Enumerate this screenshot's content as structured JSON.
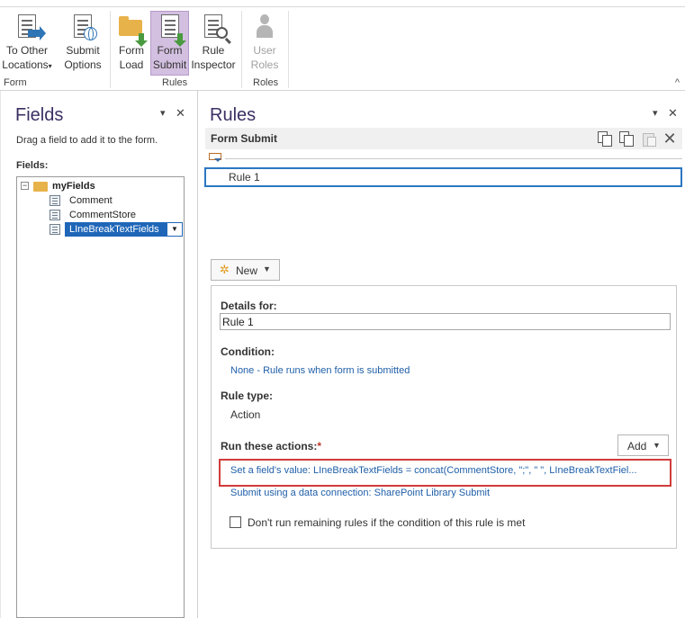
{
  "ribbon": {
    "buttons": [
      {
        "line1": "To Other",
        "line2": "Locations",
        "caret": "▾",
        "icon": "export-document-icon"
      },
      {
        "line1": "Submit",
        "line2": "Options",
        "icon": "submit-options-icon"
      },
      {
        "line1": "Form",
        "line2": "Load",
        "icon": "form-load-icon"
      },
      {
        "line1": "Form",
        "line2": "Submit",
        "icon": "form-submit-icon",
        "active": true
      },
      {
        "line1": "Rule",
        "line2": "Inspector",
        "icon": "rule-inspector-icon"
      },
      {
        "line1": "User",
        "line2": "Roles",
        "icon": "user-roles-icon",
        "disabled": true
      }
    ],
    "groups": [
      "Form",
      "Rules",
      "Roles"
    ],
    "collapse_glyph": "^"
  },
  "fields_pane": {
    "title": "Fields",
    "hint": "Drag a field to add it to the form.",
    "fields_label": "Fields:",
    "tree": {
      "root": "myFields",
      "expander": "−",
      "children": [
        "Comment",
        "CommentStore",
        "LIneBreakTextFields"
      ]
    },
    "pin_glyph": "▾",
    "close_glyph": "✕",
    "dropdown_glyph": "▼"
  },
  "rules_pane": {
    "title": "Rules",
    "subtitle": "Form Submit",
    "pin_glyph": "▾",
    "close_glyph": "✕",
    "delete_glyph": "✕",
    "rule_name": "Rule 1",
    "new_button": {
      "label": "New",
      "caret": "▼",
      "icon_glyph": "✲"
    },
    "details": {
      "details_for_label": "Details for:",
      "details_for_value": "Rule 1",
      "condition_label": "Condition:",
      "condition_value": "None - Rule runs when form is submitted",
      "rule_type_label": "Rule type:",
      "rule_type_value": "Action",
      "actions_label": "Run these actions:",
      "required_mark": "*",
      "add_button": {
        "label": "Add",
        "caret": "▼"
      },
      "actions": [
        "Set a field's value: LIneBreakTextFields = concat(CommentStore, \";\", \" \", LIneBreakTextFiel...",
        "Submit using a data connection: SharePoint Library Submit"
      ],
      "checkbox_label": "Don't run remaining rules if the condition of this rule is met",
      "checkbox_checked": false
    }
  },
  "colors": {
    "accent_purple": "#3b2f63",
    "selection_blue": "#1f66b8",
    "link_blue": "#1f5fa8",
    "highlight_red": "#d23b3b",
    "active_button": "#d3bfe0"
  }
}
